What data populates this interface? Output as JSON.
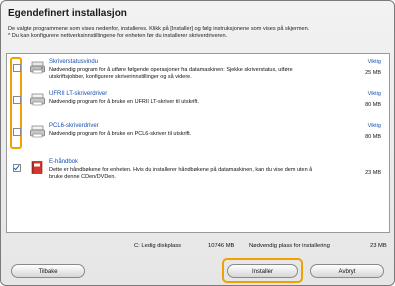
{
  "dialog": {
    "title": "Egendefinert installasjon",
    "intro_line1": "De valgte programmene som vises nedenfor, installeres. Klikk på [Installer] og følg instruksjonene som vises på skjermen.",
    "intro_line2": "* Du kan konfigurere nettverksinnstillingene for enheten før du installerer skriverdriveren."
  },
  "items": [
    {
      "name": "Skriverstatusvindu",
      "desc": "Nødvendig program for å utføre følgende operasjoner fra datamaskinen: Sjekke skriverstatus, utføre utskriftsjobber, konfigurere skriverinnstillinger og så videre.",
      "importance": "Viktig",
      "size": "25 MB",
      "checked": false,
      "icon": "printer-status-icon"
    },
    {
      "name": "UFRII LT-skriverdriver",
      "desc": "Nødvendig program for å bruke en UFRII LT-skriver til utskrift.",
      "importance": "Viktig",
      "size": "80 MB",
      "checked": false,
      "icon": "printer-icon"
    },
    {
      "name": "PCL6-skriverdriver",
      "desc": "Nødvendig program for å bruke en PCL6-skriver til utskrift.",
      "importance": "Viktig",
      "size": "80 MB",
      "checked": false,
      "icon": "printer-icon"
    },
    {
      "name": "E-håndbok",
      "desc": "Dette er håndbøkene for enheten. Hvis du installerer håndbøkene på datamaskinen, kan du vise dem uten å bruke denne CDen/DVDen.",
      "importance": "",
      "size": "23 MB",
      "checked": true,
      "icon": "book-icon"
    }
  ],
  "summary": {
    "disk_label": "C: Ledig diskplass",
    "disk_value": "10746 MB",
    "needed_label": "Nødvendig plass for installering",
    "needed_value": "23 MB"
  },
  "buttons": {
    "back": "Tilbake",
    "install": "Installer",
    "cancel": "Avbryt"
  },
  "colors": {
    "highlight": "#f0a000",
    "link": "#1a4fb0"
  }
}
